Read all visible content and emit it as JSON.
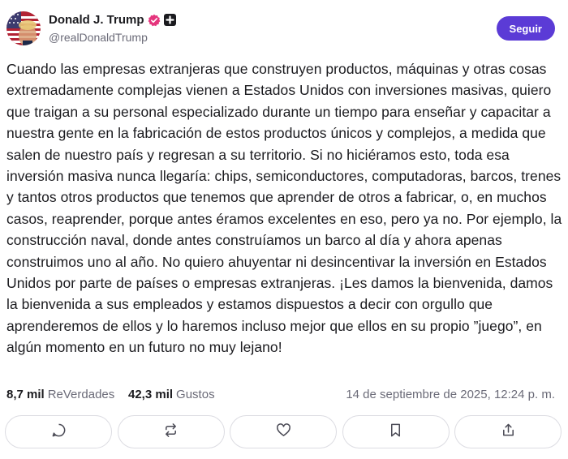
{
  "author": {
    "name": "Donald J. Trump",
    "handle": "@realDonaldTrump",
    "avatar_icon": "avatar-flag-portrait",
    "verified_icon": "verified-badge-icon",
    "plus_icon": "plus-badge-icon"
  },
  "follow_button": {
    "label": "Seguir",
    "color": "#5b3bd6"
  },
  "post": {
    "text": "Cuando las empresas extranjeras que construyen productos, máquinas y otras cosas extremadamente complejas vienen a Estados Unidos con inversiones masivas, quiero que traigan a su personal especializado durante un tiempo para enseñar y capacitar a nuestra gente en la fabricación de estos productos únicos y complejos, a medida que salen de nuestro país y regresan a su territorio. Si no hiciéramos esto, toda esa inversión masiva nunca llegaría: chips, semiconductores, computadoras, barcos, trenes y tantos otros productos que tenemos que aprender de otros a fabricar, o, en muchos casos, reaprender, porque antes éramos excelentes en eso, pero ya no. Por ejemplo, la construcción naval, donde antes construíamos un barco al día y ahora apenas construimos uno al año. No quiero ahuyentar ni desincentivar la inversión en Estados Unidos por parte de países o empresas extranjeras. ¡Les damos la bienvenida, damos la bienvenida a sus empleados y estamos dispuestos a decir con orgullo que aprenderemos de ellos y lo haremos incluso mejor que ellos en su propio ”juego”, en algún momento en un futuro no muy lejano!"
  },
  "stats": {
    "retruths_count": "8,7 mil",
    "retruths_label": "ReVerdades",
    "likes_count": "42,3 mil",
    "likes_label": "Gustos",
    "date": "14 de septiembre de 2025, 12:24 p. m."
  },
  "actions": [
    {
      "icon": "reply-icon"
    },
    {
      "icon": "retruth-icon"
    },
    {
      "icon": "like-icon"
    },
    {
      "icon": "bookmark-icon"
    },
    {
      "icon": "share-icon"
    }
  ]
}
